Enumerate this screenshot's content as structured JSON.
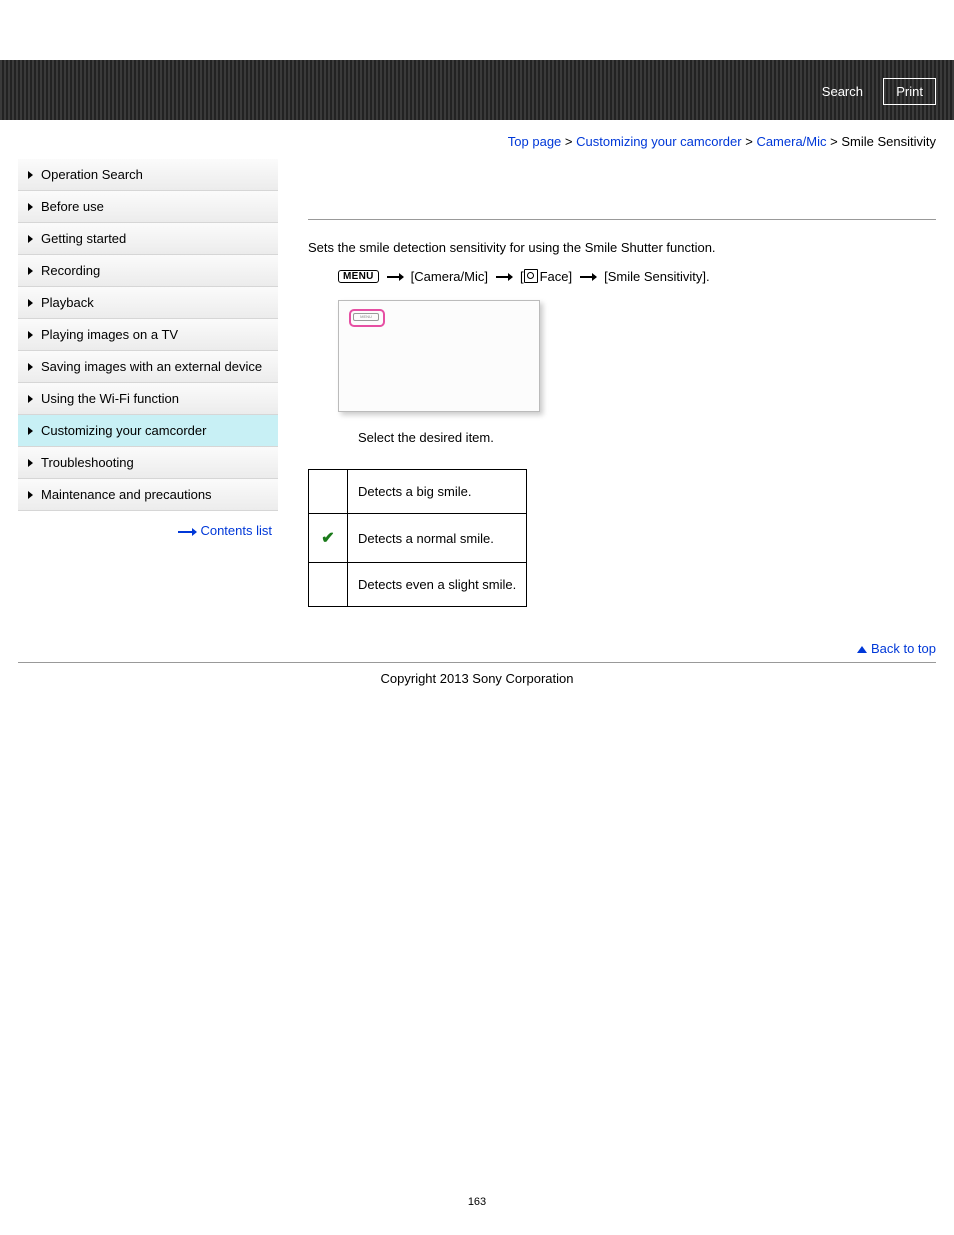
{
  "header": {
    "search_label": "Search",
    "print_label": "Print"
  },
  "breadcrumb": {
    "items": [
      "Top page",
      "Customizing your camcorder",
      "Camera/Mic",
      "Smile Sensitivity"
    ],
    "sep": ">"
  },
  "sidebar": {
    "items": [
      {
        "label": "Operation Search",
        "active": false
      },
      {
        "label": "Before use",
        "active": false
      },
      {
        "label": "Getting started",
        "active": false
      },
      {
        "label": "Recording",
        "active": false
      },
      {
        "label": "Playback",
        "active": false
      },
      {
        "label": "Playing images on a TV",
        "active": false
      },
      {
        "label": "Saving images with an external device",
        "active": false
      },
      {
        "label": "Using the Wi-Fi function",
        "active": false
      },
      {
        "label": "Customizing your camcorder",
        "active": true
      },
      {
        "label": "Troubleshooting",
        "active": false
      },
      {
        "label": "Maintenance and precautions",
        "active": false
      }
    ],
    "contents_link": "Contents list"
  },
  "content": {
    "description": "Sets the smile detection sensitivity for using the Smile Shutter function.",
    "menu_button": "MENU",
    "nav_steps": [
      "[Camera/Mic]",
      "Face]",
      "[Smile Sensitivity]."
    ],
    "screen_inner_label": "MENU",
    "instruction": "Select the desired item.",
    "options": [
      {
        "checked": false,
        "text": "Detects a big smile."
      },
      {
        "checked": true,
        "text": "Detects a normal smile."
      },
      {
        "checked": false,
        "text": "Detects even a slight smile."
      }
    ]
  },
  "back_to_top": "Back to top",
  "copyright": "Copyright 2013 Sony Corporation",
  "page_number": "163"
}
